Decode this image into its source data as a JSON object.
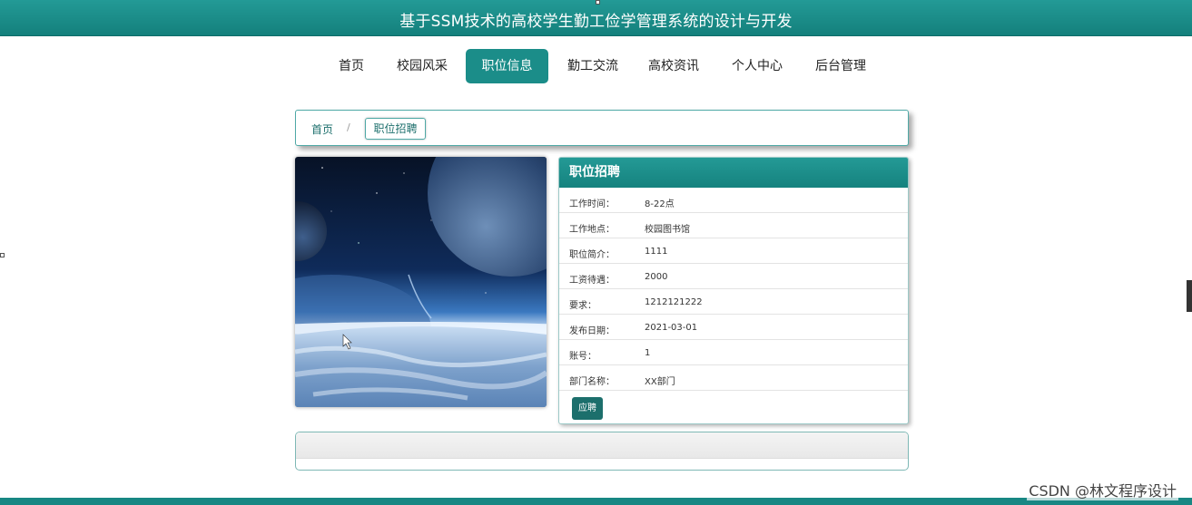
{
  "header": {
    "title": "基于SSM技术的高校学生勤工俭学管理系统的设计与开发"
  },
  "nav": {
    "items": [
      {
        "label": "首页"
      },
      {
        "label": "校园风采"
      },
      {
        "label": "职位信息"
      },
      {
        "label": "勤工交流"
      },
      {
        "label": "高校资讯"
      },
      {
        "label": "个人中心"
      },
      {
        "label": "后台管理"
      }
    ],
    "active_index": 2
  },
  "breadcrumb": {
    "home": "首页",
    "separator": "/",
    "current": "职位招聘"
  },
  "detail": {
    "title": "职位招聘",
    "rows": [
      {
        "label": "工作时间：",
        "value": "8-22点"
      },
      {
        "label": "工作地点：",
        "value": "校园图书馆"
      },
      {
        "label": "职位简介：",
        "value": "1111"
      },
      {
        "label": "工资待遇：",
        "value": "2000"
      },
      {
        "label": "要求：",
        "value": "1212121222"
      },
      {
        "label": "发布日期：",
        "value": "2021-03-01"
      },
      {
        "label": "账号：",
        "value": "1"
      },
      {
        "label": "部门名称：",
        "value": "XX部门"
      }
    ],
    "apply_label": "应聘"
  },
  "watermark": "CSDN @林文程序设计",
  "colors": {
    "primary": "#1b8d89",
    "primary_dark": "#1c6f6c",
    "border": "#4fa9a6"
  }
}
